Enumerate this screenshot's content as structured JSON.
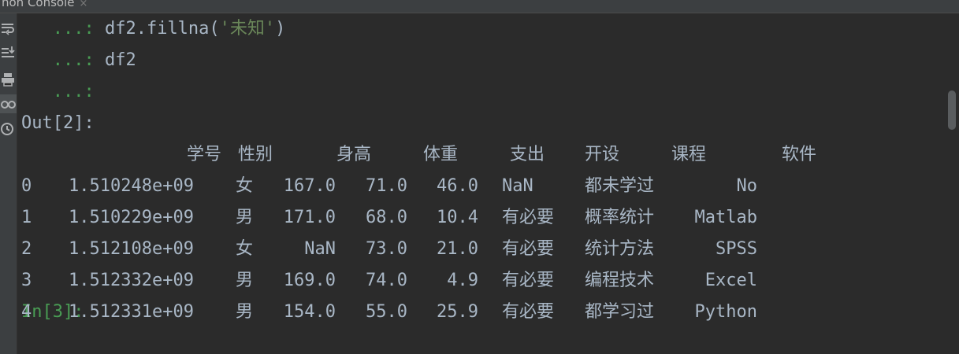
{
  "tab": {
    "title": "hon Console",
    "close": "×"
  },
  "console": {
    "cont1": "   ...: ",
    "code1_a": "df2.fillna(",
    "code1_s": "'未知'",
    "code1_b": ")",
    "cont2": "   ...: ",
    "code2": "df2",
    "cont3": "   ...:",
    "out_prompt": "Out[2]:",
    "in_prompt": "In[3]:"
  },
  "table": {
    "headers": [
      "学号",
      "性别",
      "身高",
      "体重",
      "支出",
      "开设",
      "课程",
      "软件"
    ],
    "rows": [
      [
        "0",
        "1.510248e+09",
        "女",
        "167.0",
        "71.0",
        "46.0",
        "NaN",
        "都未学过",
        "No"
      ],
      [
        "1",
        "1.510229e+09",
        "男",
        "171.0",
        "68.0",
        "10.4",
        "有必要",
        "概率统计",
        "Matlab"
      ],
      [
        "2",
        "1.512108e+09",
        "女",
        "NaN",
        "73.0",
        "21.0",
        "有必要",
        "统计方法",
        "SPSS"
      ],
      [
        "3",
        "1.512332e+09",
        "男",
        "169.0",
        "74.0",
        "4.9",
        "有必要",
        "编程技术",
        "Excel"
      ],
      [
        "4",
        "1.512331e+09",
        "男",
        "154.0",
        "55.0",
        "25.9",
        "有必要",
        "都学习过",
        "Python"
      ]
    ]
  }
}
